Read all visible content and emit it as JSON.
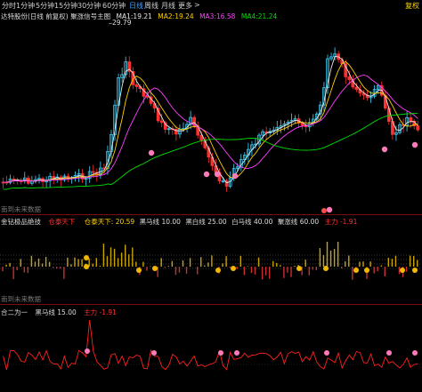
{
  "toolbar": {
    "items": [
      {
        "label": "分时",
        "active": false
      },
      {
        "label": "1分钟",
        "active": false
      },
      {
        "label": "5分钟",
        "active": false
      },
      {
        "label": "15分钟",
        "active": false
      },
      {
        "label": "30分钟",
        "active": false
      },
      {
        "label": "60分钟",
        "active": false
      },
      {
        "label": "日线",
        "active": true
      },
      {
        "label": "周线",
        "active": false
      },
      {
        "label": "月线",
        "active": false
      },
      {
        "label": "更多",
        "active": false
      }
    ],
    "arrow": ">",
    "favorite": "复权"
  },
  "main_panel": {
    "title": "达特股份(日线 前复权) 聚涨信号主图",
    "ma": [
      {
        "label": "MA1:",
        "value": "19.21",
        "color": "#e8e8e8"
      },
      {
        "label": "MA2:",
        "value": "19.24",
        "color": "#ffd000"
      },
      {
        "label": "MA3:",
        "value": "16.58",
        "color": "#ff40ff"
      },
      {
        "label": "MA4:",
        "value": "21.24",
        "color": "#00e000"
      }
    ],
    "high_price": "29.79",
    "future_label": "南到未来数据"
  },
  "panel2": {
    "title": "金钻极品绝技",
    "items": [
      {
        "text": "仓泰天下",
        "color": "#ff3030"
      },
      {
        "text": "仓泰天下: 20.59",
        "color": "#ffd000"
      },
      {
        "text": "黑马线 10.00",
        "color": "#dddddd"
      },
      {
        "text": "黑白线 25.00",
        "color": "#dddddd"
      },
      {
        "text": "白马线 40.00",
        "color": "#dddddd"
      },
      {
        "text": "聚涨线 60.00",
        "color": "#dddddd"
      },
      {
        "text": "主力 -1.91",
        "color": "#ff3030"
      }
    ],
    "future_label": "南到未来数据"
  },
  "panel3": {
    "title": "合二为一",
    "items": [
      {
        "text": "黑马线 15.00",
        "color": "#dddddd"
      },
      {
        "text": "主力 -1.91",
        "color": "#ff3030"
      }
    ]
  },
  "colors": {
    "up": "#3fd7ff",
    "down": "#ff3030",
    "ma1": "#e8e8e8",
    "ma2": "#ffd000",
    "ma3": "#ff40ff",
    "ma4": "#00e000",
    "bar_up": "#c8a400",
    "bar_down": "#c83030"
  }
}
